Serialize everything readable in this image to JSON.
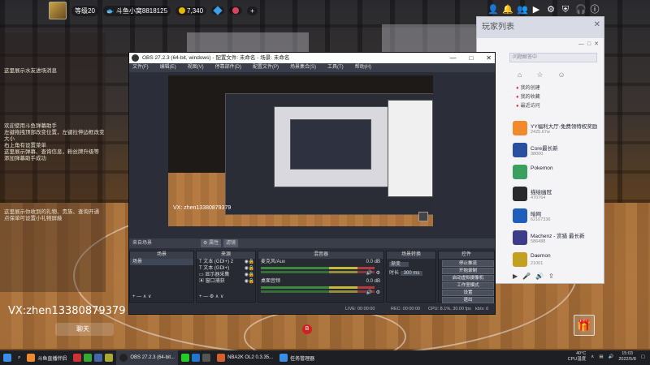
{
  "stream": {
    "level_label": "等级20",
    "fish_bar_label": "斗鱼小窝8818125",
    "coins": "7,340",
    "chat_notice": "这里展示水友进场消息",
    "chat_lines": [
      "欢迎使用斗鱼弹幕助手",
      "左键拖拽顶部改变位置，左键拉伸边框改变大小",
      "右上角有设置菜单",
      "这里展示弹幕、查询信息，粉丝牌升级等",
      "添加弹幕助手成功"
    ],
    "chat_lines2": [
      "这里展示你收到的礼物、贵族、查询开通",
      "点保单可设置小礼物屏蔽"
    ],
    "watermark": "VX:zhen13380879379",
    "send_label": "聊天",
    "center_badge": "B"
  },
  "player_list": {
    "title": "玩家列表",
    "search_placeholder": "问题解答中",
    "nav": [
      "我的创建",
      "我的收藏",
      "最近访问"
    ],
    "items": [
      {
        "name": "YY福利大厅-免费领特权奖励",
        "sub": "2425.67w",
        "color": "#f08a2c"
      },
      {
        "name": "Core最长新",
        "sub": "38000",
        "color": "#2b4fa0"
      },
      {
        "name": "Pokemon",
        "sub": "",
        "color": "#3aa060"
      },
      {
        "name": "描绘幽冠",
        "sub": "470764",
        "color": "#2a2a2a"
      },
      {
        "name": "暗网",
        "sub": "62107336",
        "color": "#1f5ebb"
      },
      {
        "name": "Machenz - 赏猎 最长新",
        "sub": "586488",
        "color": "#3c3c8a"
      },
      {
        "name": "Daemon",
        "sub": "21001",
        "color": "#c4a020"
      }
    ]
  },
  "obs": {
    "title": "OBS 27.2.3 (64-bit, windows) - 配置文件: 未命名 - 场景: 未命名",
    "menu": [
      "文件(F)",
      "编辑(E)",
      "视图(V)",
      "停靠部件(D)",
      "配置文件(P)",
      "场景集合(S)",
      "工具(T)",
      "帮助(H)"
    ],
    "source_bar_label": "来自场景",
    "props_label": "属性",
    "filter_label": "滤镜",
    "docks": {
      "scenes": {
        "title": "场景",
        "items": [
          "场景"
        ]
      },
      "sources": {
        "title": "来源",
        "items": [
          "文本 (GDI+) 2",
          "文本 (GDI+)",
          "显示器采集",
          "窗口捕获"
        ]
      },
      "mixer": {
        "title": "混音器",
        "items": [
          {
            "name": "桌面音频",
            "level": "0.0 dB"
          },
          {
            "name": "麦克风/Aux",
            "level": "0.0 dB"
          }
        ]
      },
      "transitions": {
        "title": "场景转换",
        "mode": "渐变",
        "duration_label": "时长",
        "duration": "300 ms"
      },
      "controls": {
        "title": "控件",
        "buttons": [
          "停止推流",
          "开始录制",
          "启动虚拟摄像机",
          "工作室模式",
          "设置",
          "退出"
        ]
      }
    },
    "status": {
      "live": "LIVE: 00:00:00",
      "rec": "REC: 00:00:00",
      "cpu": "CPU: 8.1%, 30.00 fps",
      "kbps": "kb/s: 0"
    },
    "preview_caption": "VX: zhen13380879379"
  },
  "taskbar": {
    "items": [
      "斗鱼直播伴侣",
      "OBS 27.2.3 (64-bit...",
      "NBA2K OL2 0.3.35...",
      "任务管理器"
    ],
    "temp": "40°C",
    "cpu_label": "CPU温度",
    "time": "15:03",
    "date": "2022/5/8"
  }
}
